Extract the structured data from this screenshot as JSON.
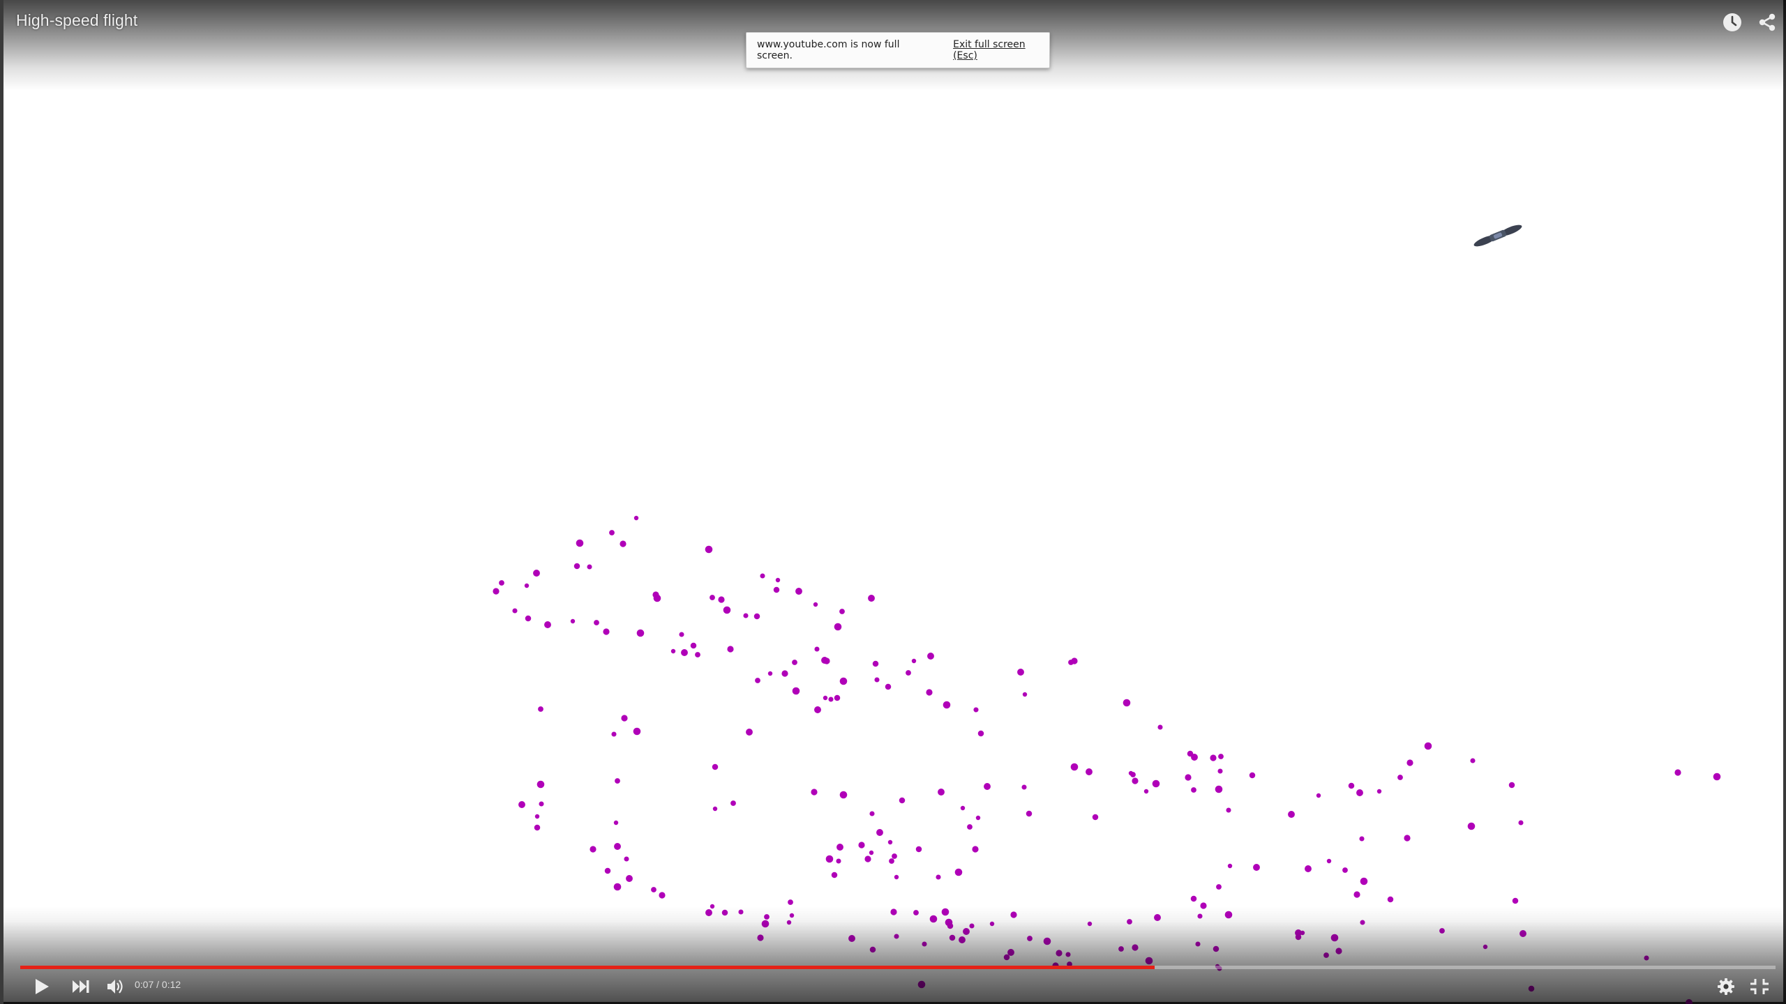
{
  "video": {
    "title": "High-speed flight",
    "time": "0:07 / 0:12",
    "progress": 0.6463
  },
  "notice": {
    "message": "www.youtube.com is now full screen.",
    "exit_label": "Exit full screen (Esc)"
  },
  "icons": {
    "top_right": [
      "watch-later-icon",
      "share-icon"
    ],
    "controls_left": [
      "play-icon",
      "next-icon",
      "volume-icon"
    ],
    "controls_right": [
      "settings-icon",
      "fullscreen-exit-icon"
    ]
  },
  "colors": {
    "progress": "#e52117",
    "particles": "#b000b8"
  }
}
